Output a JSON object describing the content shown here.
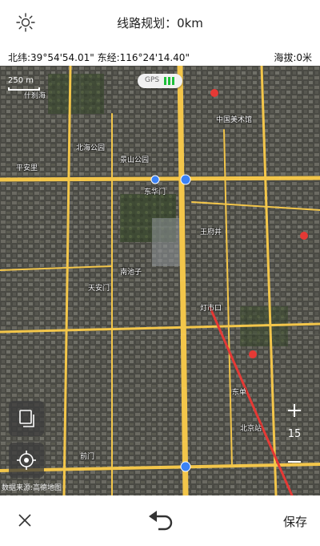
{
  "header": {
    "title": "线路规划：0km",
    "sun_icon": "sun-brightness-icon"
  },
  "coords": {
    "position": "北纬:39°54'54.01\" 东经:116°24'14.40\"",
    "altitude": "海拔:0米"
  },
  "map": {
    "gps_label": "GPS",
    "gps_color": "#1fbf3a",
    "scale_label": "250 m",
    "zoom_level": "15",
    "attribution": "数据来源:高德地图",
    "route_color": "#e53935",
    "road_color": "#f3c64a",
    "labels": {
      "l1": "什刹海",
      "l2": "平安里",
      "l3": "北海公园",
      "l4": "景山公园",
      "l5": "中国美术馆",
      "l6": "王府井",
      "l7": "东华门",
      "l8": "天安门",
      "l9": "南池子",
      "l10": "前门",
      "l11": "灯市口",
      "l12": "东单",
      "l13": "北京站"
    }
  },
  "bottom": {
    "close_icon": "close-icon",
    "undo_icon": "undo-icon",
    "save_label": "保存"
  }
}
